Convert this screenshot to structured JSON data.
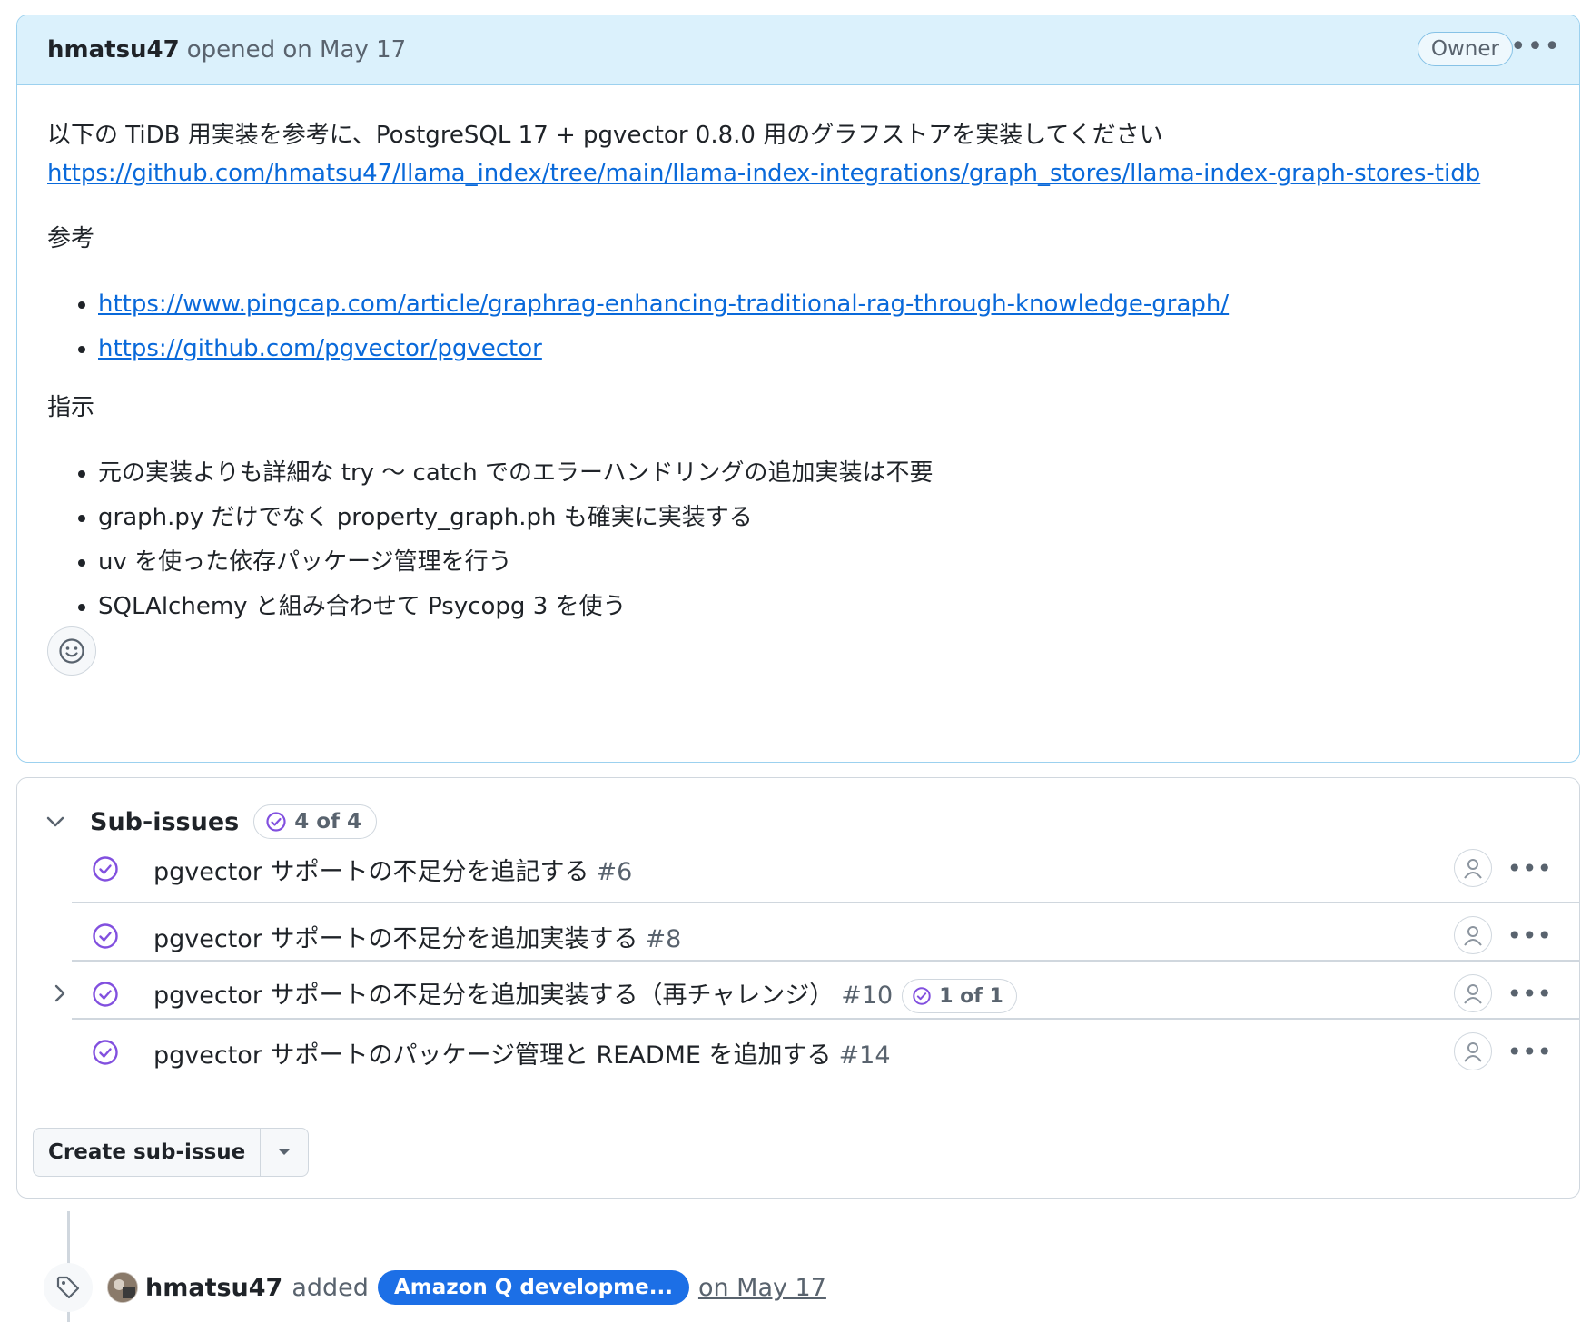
{
  "comment": {
    "author": "hmatsu47",
    "opened_text": "opened on May 17",
    "owner_badge": "Owner",
    "body": {
      "intro": "以下の TiDB 用実装を参考に、PostgreSQL 17 + pgvector 0.8.0 用のグラフストアを実装してください",
      "intro_link": "https://github.com/hmatsu47/llama_index/tree/main/llama-index-integrations/graph_stores/llama-index-graph-stores-tidb",
      "ref_heading": "参考",
      "ref_links": [
        "https://www.pingcap.com/article/graphrag-enhancing-traditional-rag-through-knowledge-graph/",
        "https://github.com/pgvector/pgvector"
      ],
      "instr_heading": "指示",
      "instructions": [
        "元の実装よりも詳細な try 〜 catch でのエラーハンドリングの追加実装は不要",
        "graph.py だけでなく property_graph.ph も確実に実装する",
        "uv を使った依存パッケージ管理を行う",
        "SQLAlchemy と組み合わせて Psycopg 3 を使う"
      ]
    }
  },
  "subissues": {
    "title": "Sub-issues",
    "count": "4 of 4",
    "items": [
      {
        "title": "pgvector サポートの不足分を追記する",
        "number": "#6"
      },
      {
        "title": "pgvector サポートの不足分を追加実装する",
        "number": "#8"
      },
      {
        "title": "pgvector サポートの不足分を追加実装する（再チャレンジ）",
        "number": "#10",
        "sub_count": "1 of 1"
      },
      {
        "title": "pgvector サポートのパッケージ管理と README を追加する",
        "number": "#14"
      }
    ],
    "create_button": "Create sub-issue"
  },
  "event": {
    "author": "hmatsu47",
    "action": "added",
    "label": "Amazon Q developme...",
    "date": "on May 17"
  },
  "colors": {
    "header_bg": "#dbf1fc",
    "link": "#0969da",
    "done_purple": "#8250df",
    "label_blue": "#1c6fe6"
  }
}
